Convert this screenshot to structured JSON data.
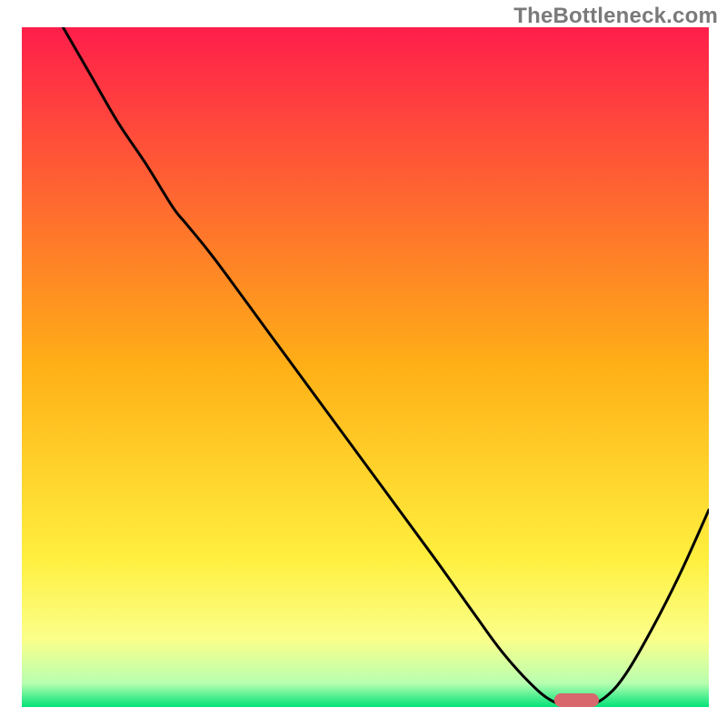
{
  "watermark": "TheBottleneck.com",
  "chart_data": {
    "type": "line",
    "title": "",
    "xlabel": "",
    "ylabel": "",
    "xlim": [
      0,
      100
    ],
    "ylim": [
      0,
      100
    ],
    "grid": false,
    "legend": false,
    "background_gradient": {
      "stops": [
        {
          "offset": 0.0,
          "color": "#ff1e4b"
        },
        {
          "offset": 0.5,
          "color": "#ffb016"
        },
        {
          "offset": 0.78,
          "color": "#ffef3e"
        },
        {
          "offset": 0.9,
          "color": "#fbff8a"
        },
        {
          "offset": 0.965,
          "color": "#b8ffb0"
        },
        {
          "offset": 1.0,
          "color": "#00e278"
        }
      ]
    },
    "series": [
      {
        "name": "curve",
        "type": "line",
        "color": "#000000",
        "x": [
          6,
          10,
          14,
          18,
          22,
          24,
          28,
          36,
          44,
          52,
          60,
          66,
          70,
          74,
          77,
          80,
          82,
          85,
          88,
          92,
          96,
          100
        ],
        "y": [
          100,
          93,
          86,
          80,
          73.5,
          71,
          66,
          55,
          44,
          33,
          22,
          13.5,
          8,
          3.5,
          1,
          0,
          0,
          1.5,
          5,
          12,
          20,
          29
        ]
      },
      {
        "name": "marker",
        "type": "marker",
        "color": "#d7676d",
        "shape": "rounded-bar",
        "x_range": [
          77.5,
          84
        ],
        "y": 0,
        "height_pct": 2.0
      }
    ]
  }
}
